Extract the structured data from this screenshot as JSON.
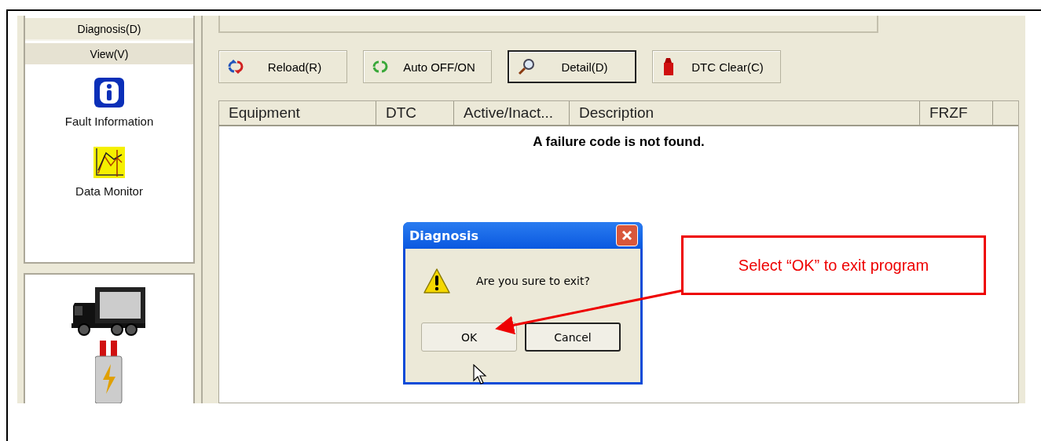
{
  "sidebar": {
    "tabs": [
      {
        "label": "Diagnosis(D)",
        "selected": false
      },
      {
        "label": "View(V)",
        "selected": true
      }
    ],
    "items": [
      {
        "kind": "info",
        "label": "Fault Information"
      },
      {
        "kind": "chart",
        "label": "Data Monitor"
      }
    ]
  },
  "toolbar": [
    {
      "kind": "reload",
      "label": "Reload(R)",
      "focused": false
    },
    {
      "kind": "auto",
      "label": "Auto OFF/ON",
      "focused": false
    },
    {
      "kind": "detail",
      "label": "Detail(D)",
      "focused": true
    },
    {
      "kind": "clear",
      "label": "DTC Clear(C)",
      "focused": false
    }
  ],
  "table": {
    "columns": [
      "Equipment",
      "DTC",
      "Active/Inact...",
      "Description",
      "FRZF"
    ],
    "empty_message": "A failure code is not found."
  },
  "dialog": {
    "title": "Diagnosis",
    "message": "Are you sure to exit?",
    "buttons": [
      {
        "label": "OK",
        "focused": false
      },
      {
        "label": "Cancel",
        "focused": true
      }
    ]
  },
  "callout": {
    "text": "Select “OK” to exit program"
  }
}
